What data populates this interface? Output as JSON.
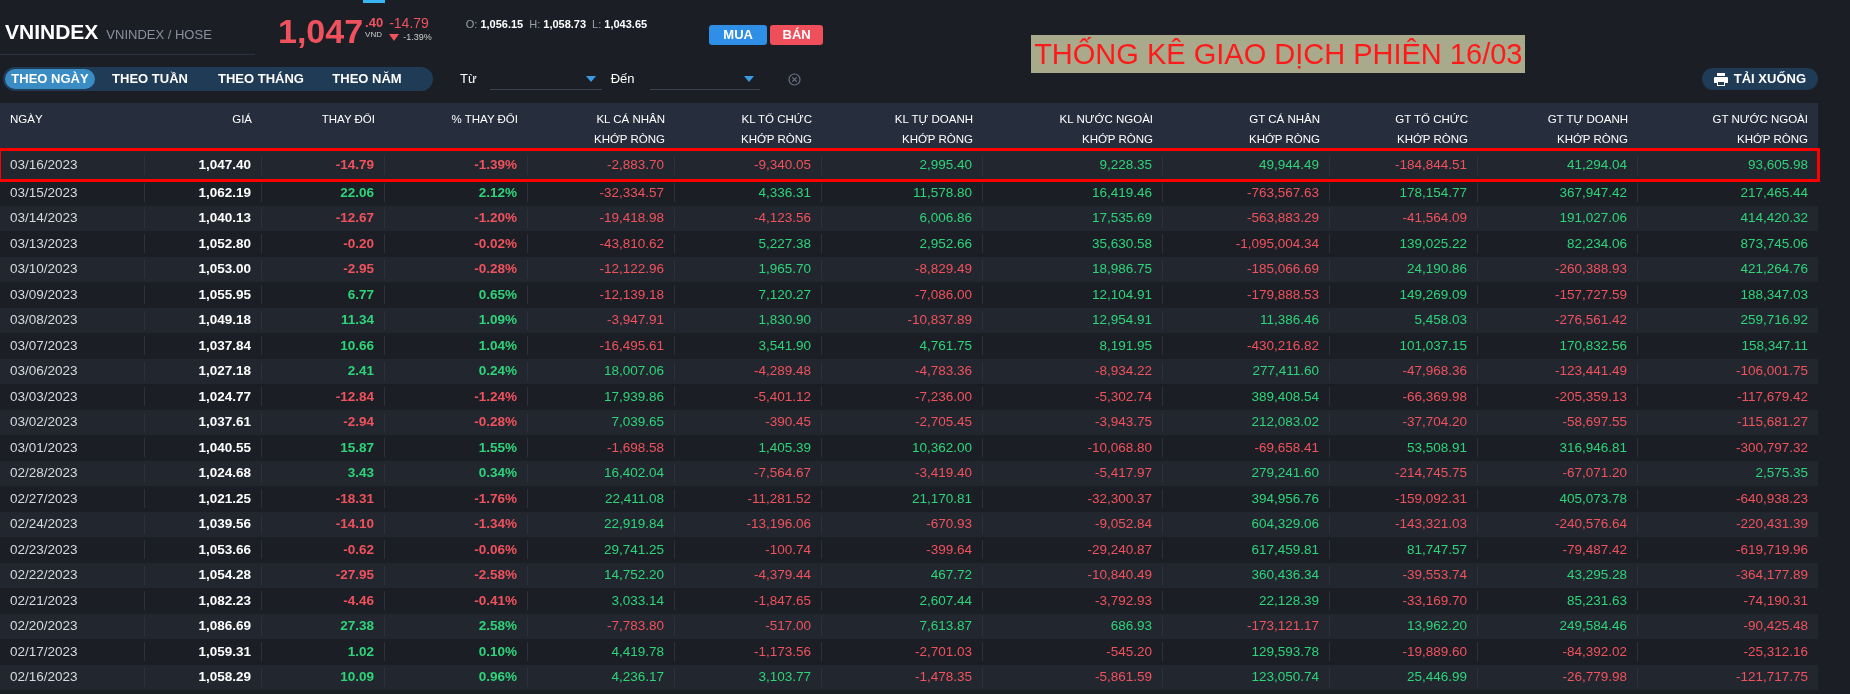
{
  "symbol": {
    "name": "VNINDEX",
    "exchange": "VNINDEX / HOSE"
  },
  "quote": {
    "price": "1,047",
    "decimal": ".40",
    "unit": "VND",
    "change": "-14.79",
    "change_pct": "-1.39%",
    "falling": true
  },
  "ohl": [
    {
      "label": "O:",
      "value": "1,056.15"
    },
    {
      "label": "H:",
      "value": "1,058.73"
    },
    {
      "label": "L:",
      "value": "1,043.65"
    }
  ],
  "actions": [
    {
      "label": "MUA",
      "kind": "buy"
    },
    {
      "label": "BÁN",
      "kind": "sell"
    }
  ],
  "banner": "THỐNG KÊ GIAO DỊCH PHIÊN 16/03",
  "tabs": [
    {
      "label": "THEO NGÀY",
      "selected": true
    },
    {
      "label": "THEO TUẦN",
      "selected": false
    },
    {
      "label": "THEO THÁNG",
      "selected": false
    },
    {
      "label": "THEO NĂM",
      "selected": false
    }
  ],
  "date_range": {
    "from_label": "Từ",
    "to_label": "Đến"
  },
  "download": "TẢI XUỐNG",
  "table": {
    "columns": [
      {
        "lines": [
          "NGÀY"
        ]
      },
      {
        "lines": [
          "GIÁ"
        ]
      },
      {
        "lines": [
          "THAY ĐỔI"
        ]
      },
      {
        "lines": [
          "% THAY ĐỔI"
        ]
      },
      {
        "lines": [
          "KL CÁ NHÂN",
          "KHỚP RÒNG"
        ]
      },
      {
        "lines": [
          "KL TỔ CHỨC",
          "KHỚP RÒNG"
        ]
      },
      {
        "lines": [
          "KL TỰ DOANH",
          "KHỚP RÒNG"
        ]
      },
      {
        "lines": [
          "KL NƯỚC NGOÀI",
          "KHỚP RÒNG"
        ]
      },
      {
        "lines": [
          "GT CÁ NHÂN",
          "KHỚP RÒNG"
        ]
      },
      {
        "lines": [
          "GT TỔ CHỨC",
          "KHỚP RÒNG"
        ]
      },
      {
        "lines": [
          "GT TỰ DOANH",
          "KHỚP RÒNG"
        ]
      },
      {
        "lines": [
          "GT NƯỚC NGOÀI",
          "KHỚP RÒNG"
        ]
      }
    ],
    "rows": [
      {
        "highlighted": true,
        "cells": [
          "03/16/2023",
          "1,047.40",
          "-14.79",
          "-1.39%",
          "-2,883.70",
          "-9,340.05",
          "2,995.40",
          "9,228.35",
          "49,944.49",
          "-184,844.51",
          "41,294.04",
          "93,605.98"
        ],
        "up": [
          false,
          false,
          false,
          false,
          true,
          true,
          true,
          false,
          true,
          true
        ]
      },
      {
        "highlighted": false,
        "cells": [
          "03/15/2023",
          "1,062.19",
          "22.06",
          "2.12%",
          "-32,334.57",
          "4,336.31",
          "11,578.80",
          "16,419.46",
          "-763,567.63",
          "178,154.77",
          "367,947.42",
          "217,465.44"
        ],
        "up": [
          true,
          true,
          false,
          true,
          true,
          true,
          false,
          true,
          true,
          true
        ]
      },
      {
        "highlighted": false,
        "cells": [
          "03/14/2023",
          "1,040.13",
          "-12.67",
          "-1.20%",
          "-19,418.98",
          "-4,123.56",
          "6,006.86",
          "17,535.69",
          "-563,883.29",
          "-41,564.09",
          "191,027.06",
          "414,420.32"
        ],
        "up": [
          false,
          false,
          false,
          false,
          true,
          true,
          false,
          false,
          true,
          true
        ]
      },
      {
        "highlighted": false,
        "cells": [
          "03/13/2023",
          "1,052.80",
          "-0.20",
          "-0.02%",
          "-43,810.62",
          "5,227.38",
          "2,952.66",
          "35,630.58",
          "-1,095,004.34",
          "139,025.22",
          "82,234.06",
          "873,745.06"
        ],
        "up": [
          false,
          false,
          false,
          true,
          true,
          true,
          false,
          true,
          true,
          true
        ]
      },
      {
        "highlighted": false,
        "cells": [
          "03/10/2023",
          "1,053.00",
          "-2.95",
          "-0.28%",
          "-12,122.96",
          "1,965.70",
          "-8,829.49",
          "18,986.75",
          "-185,066.69",
          "24,190.86",
          "-260,388.93",
          "421,264.76"
        ],
        "up": [
          false,
          false,
          false,
          true,
          false,
          true,
          false,
          true,
          false,
          true
        ]
      },
      {
        "highlighted": false,
        "cells": [
          "03/09/2023",
          "1,055.95",
          "6.77",
          "0.65%",
          "-12,139.18",
          "7,120.27",
          "-7,086.00",
          "12,104.91",
          "-179,888.53",
          "149,269.09",
          "-157,727.59",
          "188,347.03"
        ],
        "up": [
          true,
          true,
          false,
          true,
          false,
          true,
          false,
          true,
          false,
          true
        ]
      },
      {
        "highlighted": false,
        "cells": [
          "03/08/2023",
          "1,049.18",
          "11.34",
          "1.09%",
          "-3,947.91",
          "1,830.90",
          "-10,837.89",
          "12,954.91",
          "11,386.46",
          "5,458.03",
          "-276,561.42",
          "259,716.92"
        ],
        "up": [
          true,
          true,
          false,
          true,
          false,
          true,
          true,
          true,
          false,
          true
        ]
      },
      {
        "highlighted": false,
        "cells": [
          "03/07/2023",
          "1,037.84",
          "10.66",
          "1.04%",
          "-16,495.61",
          "3,541.90",
          "4,761.75",
          "8,191.95",
          "-430,216.82",
          "101,037.15",
          "170,832.56",
          "158,347.11"
        ],
        "up": [
          true,
          true,
          false,
          true,
          true,
          true,
          false,
          true,
          true,
          true
        ]
      },
      {
        "highlighted": false,
        "cells": [
          "03/06/2023",
          "1,027.18",
          "2.41",
          "0.24%",
          "18,007.06",
          "-4,289.48",
          "-4,783.36",
          "-8,934.22",
          "277,411.60",
          "-47,968.36",
          "-123,441.49",
          "-106,001.75"
        ],
        "up": [
          true,
          true,
          true,
          false,
          false,
          false,
          true,
          false,
          false,
          false
        ]
      },
      {
        "highlighted": false,
        "cells": [
          "03/03/2023",
          "1,024.77",
          "-12.84",
          "-1.24%",
          "17,939.86",
          "-5,401.12",
          "-7,236.00",
          "-5,302.74",
          "389,408.54",
          "-66,369.98",
          "-205,359.13",
          "-117,679.42"
        ],
        "up": [
          false,
          false,
          true,
          false,
          false,
          false,
          true,
          false,
          false,
          false
        ]
      },
      {
        "highlighted": false,
        "cells": [
          "03/02/2023",
          "1,037.61",
          "-2.94",
          "-0.28%",
          "7,039.65",
          "-390.45",
          "-2,705.45",
          "-3,943.75",
          "212,083.02",
          "-37,704.20",
          "-58,697.55",
          "-115,681.27"
        ],
        "up": [
          false,
          false,
          true,
          false,
          false,
          false,
          true,
          false,
          false,
          false
        ]
      },
      {
        "highlighted": false,
        "cells": [
          "03/01/2023",
          "1,040.55",
          "15.87",
          "1.55%",
          "-1,698.58",
          "1,405.39",
          "10,362.00",
          "-10,068.80",
          "-69,658.41",
          "53,508.91",
          "316,946.81",
          "-300,797.32"
        ],
        "up": [
          true,
          true,
          false,
          true,
          true,
          false,
          false,
          true,
          true,
          false
        ]
      },
      {
        "highlighted": false,
        "cells": [
          "02/28/2023",
          "1,024.68",
          "3.43",
          "0.34%",
          "16,402.04",
          "-7,564.67",
          "-3,419.40",
          "-5,417.97",
          "279,241.60",
          "-214,745.75",
          "-67,071.20",
          "2,575.35"
        ],
        "up": [
          true,
          true,
          true,
          false,
          false,
          false,
          true,
          false,
          false,
          true
        ]
      },
      {
        "highlighted": false,
        "cells": [
          "02/27/2023",
          "1,021.25",
          "-18.31",
          "-1.76%",
          "22,411.08",
          "-11,281.52",
          "21,170.81",
          "-32,300.37",
          "394,956.76",
          "-159,092.31",
          "405,073.78",
          "-640,938.23"
        ],
        "up": [
          false,
          false,
          true,
          false,
          true,
          false,
          true,
          false,
          true,
          false
        ]
      },
      {
        "highlighted": false,
        "cells": [
          "02/24/2023",
          "1,039.56",
          "-14.10",
          "-1.34%",
          "22,919.84",
          "-13,196.06",
          "-670.93",
          "-9,052.84",
          "604,329.06",
          "-143,321.03",
          "-240,576.64",
          "-220,431.39"
        ],
        "up": [
          false,
          false,
          true,
          false,
          false,
          false,
          true,
          false,
          false,
          false
        ]
      },
      {
        "highlighted": false,
        "cells": [
          "02/23/2023",
          "1,053.66",
          "-0.62",
          "-0.06%",
          "29,741.25",
          "-100.74",
          "-399.64",
          "-29,240.87",
          "617,459.81",
          "81,747.57",
          "-79,487.42",
          "-619,719.96"
        ],
        "up": [
          false,
          false,
          true,
          false,
          false,
          false,
          true,
          true,
          false,
          false
        ]
      },
      {
        "highlighted": false,
        "cells": [
          "02/22/2023",
          "1,054.28",
          "-27.95",
          "-2.58%",
          "14,752.20",
          "-4,379.44",
          "467.72",
          "-10,840.49",
          "360,436.34",
          "-39,553.74",
          "43,295.28",
          "-364,177.89"
        ],
        "up": [
          false,
          false,
          true,
          false,
          true,
          false,
          true,
          false,
          true,
          false
        ]
      },
      {
        "highlighted": false,
        "cells": [
          "02/21/2023",
          "1,082.23",
          "-4.46",
          "-0.41%",
          "3,033.14",
          "-1,847.65",
          "2,607.44",
          "-3,792.93",
          "22,128.39",
          "-33,169.70",
          "85,231.63",
          "-74,190.31"
        ],
        "up": [
          false,
          false,
          true,
          false,
          true,
          false,
          true,
          false,
          true,
          false
        ]
      },
      {
        "highlighted": false,
        "cells": [
          "02/20/2023",
          "1,086.69",
          "27.38",
          "2.58%",
          "-7,783.80",
          "-517.00",
          "7,613.87",
          "686.93",
          "-173,121.17",
          "13,962.20",
          "249,584.46",
          "-90,425.48"
        ],
        "up": [
          true,
          true,
          false,
          false,
          true,
          true,
          false,
          true,
          true,
          false
        ]
      },
      {
        "highlighted": false,
        "cells": [
          "02/17/2023",
          "1,059.31",
          "1.02",
          "0.10%",
          "4,419.78",
          "-1,173.56",
          "-2,701.03",
          "-545.20",
          "129,593.78",
          "-19,889.60",
          "-84,392.02",
          "-25,312.16"
        ],
        "up": [
          true,
          true,
          true,
          false,
          false,
          false,
          true,
          false,
          false,
          false
        ]
      },
      {
        "highlighted": false,
        "cells": [
          "02/16/2023",
          "1,058.29",
          "10.09",
          "0.96%",
          "4,236.17",
          "3,103.77",
          "-1,478.35",
          "-5,861.59",
          "123,050.74",
          "25,446.99",
          "-26,779.98",
          "-121,717.75"
        ],
        "up": [
          true,
          true,
          true,
          true,
          false,
          false,
          true,
          true,
          false,
          false
        ]
      }
    ]
  }
}
